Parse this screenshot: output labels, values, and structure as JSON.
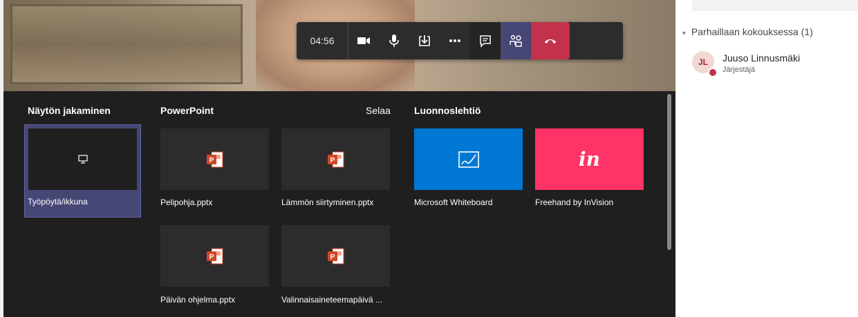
{
  "call_controls": {
    "timer": "04:56",
    "buttons": [
      "camera-icon",
      "mic-icon",
      "share-tray-icon",
      "more-icon",
      "chat-icon",
      "participants-icon",
      "hang-up-icon"
    ]
  },
  "share_tray": {
    "desktop": {
      "heading": "Näytön jakaminen",
      "tile_label": "Työpöytä/ikkuna"
    },
    "powerpoint": {
      "heading": "PowerPoint",
      "browse_label": "Selaa",
      "files": [
        "Pelipohja.pptx",
        "Lämmön siirtyminen.pptx",
        "Päivän ohjelma.pptx",
        "Valinnaisaineteemapäivä ..."
      ]
    },
    "whiteboard": {
      "heading": "Luonnoslehtiö",
      "apps": [
        {
          "label": "Microsoft Whiteboard",
          "color": "#0078d4"
        },
        {
          "label": "Freehand by InVision",
          "color": "#ff3366",
          "glyph": "in"
        }
      ]
    }
  },
  "participants": {
    "section_title": "Parhaillaan kokouksessa (1)",
    "people": [
      {
        "initials": "JL",
        "name": "Juuso Linnusmäki",
        "role": "Järjestäjä",
        "status_color": "#c4314b"
      }
    ]
  },
  "colors": {
    "accent": "#6264a7",
    "hangup": "#c4314b",
    "ppt": "#d24726"
  }
}
